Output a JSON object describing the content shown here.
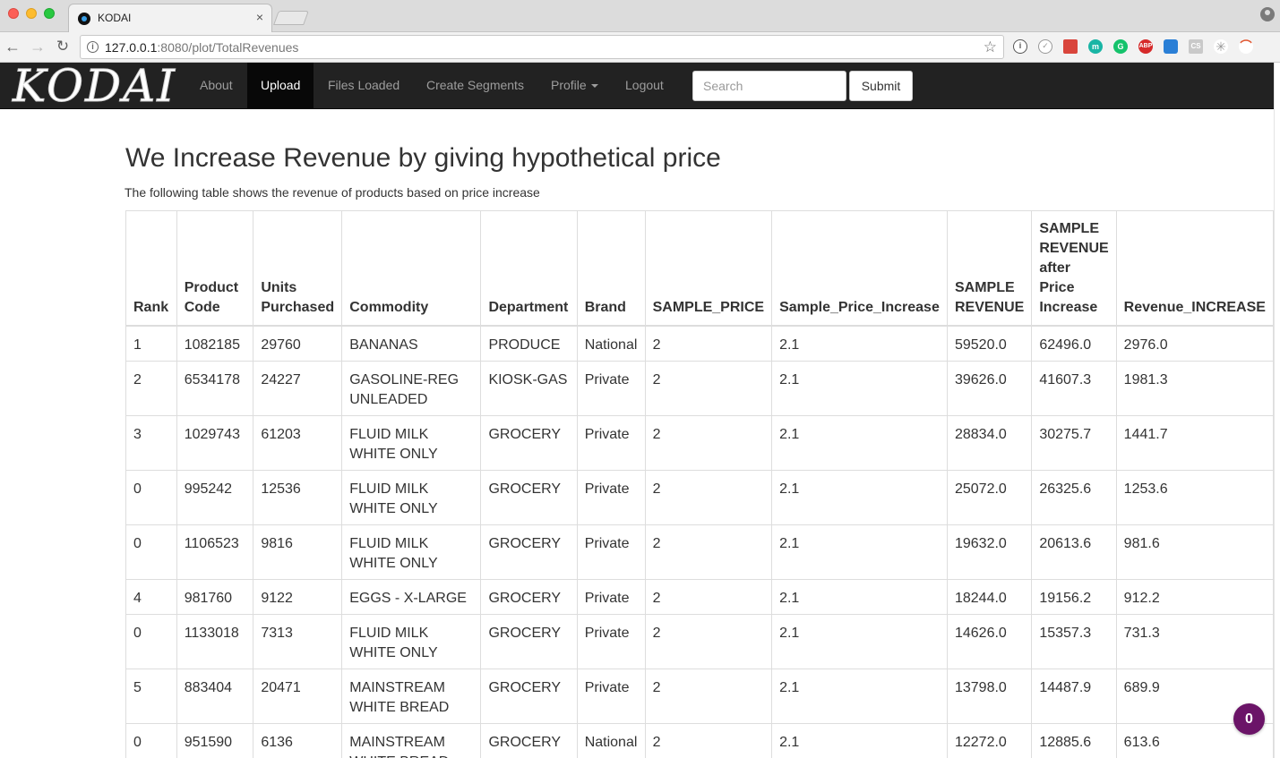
{
  "browser": {
    "tab_title": "KODAI",
    "tab_close": "×",
    "url_host": "127.0.0.1",
    "url_rest": ":8080/plot/TotalRevenues"
  },
  "navbar": {
    "brand": "KODAI",
    "items": [
      "About",
      "Upload",
      "Files Loaded",
      "Create Segments",
      "Profile",
      "Logout"
    ],
    "active_item": "Upload",
    "search_placeholder": "Search",
    "submit_label": "Submit"
  },
  "page": {
    "title": "We Increase Revenue by giving hypothetical price",
    "subtitle": "The following table shows the revenue of products based on price increase"
  },
  "table": {
    "columns": [
      "Rank",
      "Product Code",
      "Units Purchased",
      "Commodity",
      "Department",
      "Brand",
      "SAMPLE_PRICE",
      "Sample_Price_Increase",
      "SAMPLE REVENUE",
      "SAMPLE REVENUE after Price Increase",
      "Revenue_INCREASE"
    ],
    "rows": [
      [
        "1",
        "1082185",
        "29760",
        "BANANAS",
        "PRODUCE",
        "National",
        "2",
        "2.1",
        "59520.0",
        "62496.0",
        "2976.0"
      ],
      [
        "2",
        "6534178",
        "24227",
        "GASOLINE-REG UNLEADED",
        "KIOSK-GAS",
        "Private",
        "2",
        "2.1",
        "39626.0",
        "41607.3",
        "1981.3"
      ],
      [
        "3",
        "1029743",
        "61203",
        "FLUID MILK WHITE ONLY",
        "GROCERY",
        "Private",
        "2",
        "2.1",
        "28834.0",
        "30275.7",
        "1441.7"
      ],
      [
        "0",
        "995242",
        "12536",
        "FLUID MILK WHITE ONLY",
        "GROCERY",
        "Private",
        "2",
        "2.1",
        "25072.0",
        "26325.6",
        "1253.6"
      ],
      [
        "0",
        "1106523",
        "9816",
        "FLUID MILK WHITE ONLY",
        "GROCERY",
        "Private",
        "2",
        "2.1",
        "19632.0",
        "20613.6",
        "981.6"
      ],
      [
        "4",
        "981760",
        "9122",
        "EGGS - X-LARGE",
        "GROCERY",
        "Private",
        "2",
        "2.1",
        "18244.0",
        "19156.2",
        "912.2"
      ],
      [
        "0",
        "1133018",
        "7313",
        "FLUID MILK WHITE ONLY",
        "GROCERY",
        "Private",
        "2",
        "2.1",
        "14626.0",
        "15357.3",
        "731.3"
      ],
      [
        "5",
        "883404",
        "20471",
        "MAINSTREAM WHITE BREAD",
        "GROCERY",
        "Private",
        "2",
        "2.1",
        "13798.0",
        "14487.9",
        "689.9"
      ],
      [
        "0",
        "951590",
        "6136",
        "MAINSTREAM WHITE BREAD",
        "GROCERY",
        "National",
        "2",
        "2.1",
        "12272.0",
        "12885.6",
        "613.6"
      ]
    ]
  },
  "chat_badge": {
    "count": "0",
    "color": "#6b1468"
  },
  "colors": {
    "navbar_bg": "#222222",
    "navbar_active_bg": "#080808",
    "table_border": "#dddddd"
  }
}
